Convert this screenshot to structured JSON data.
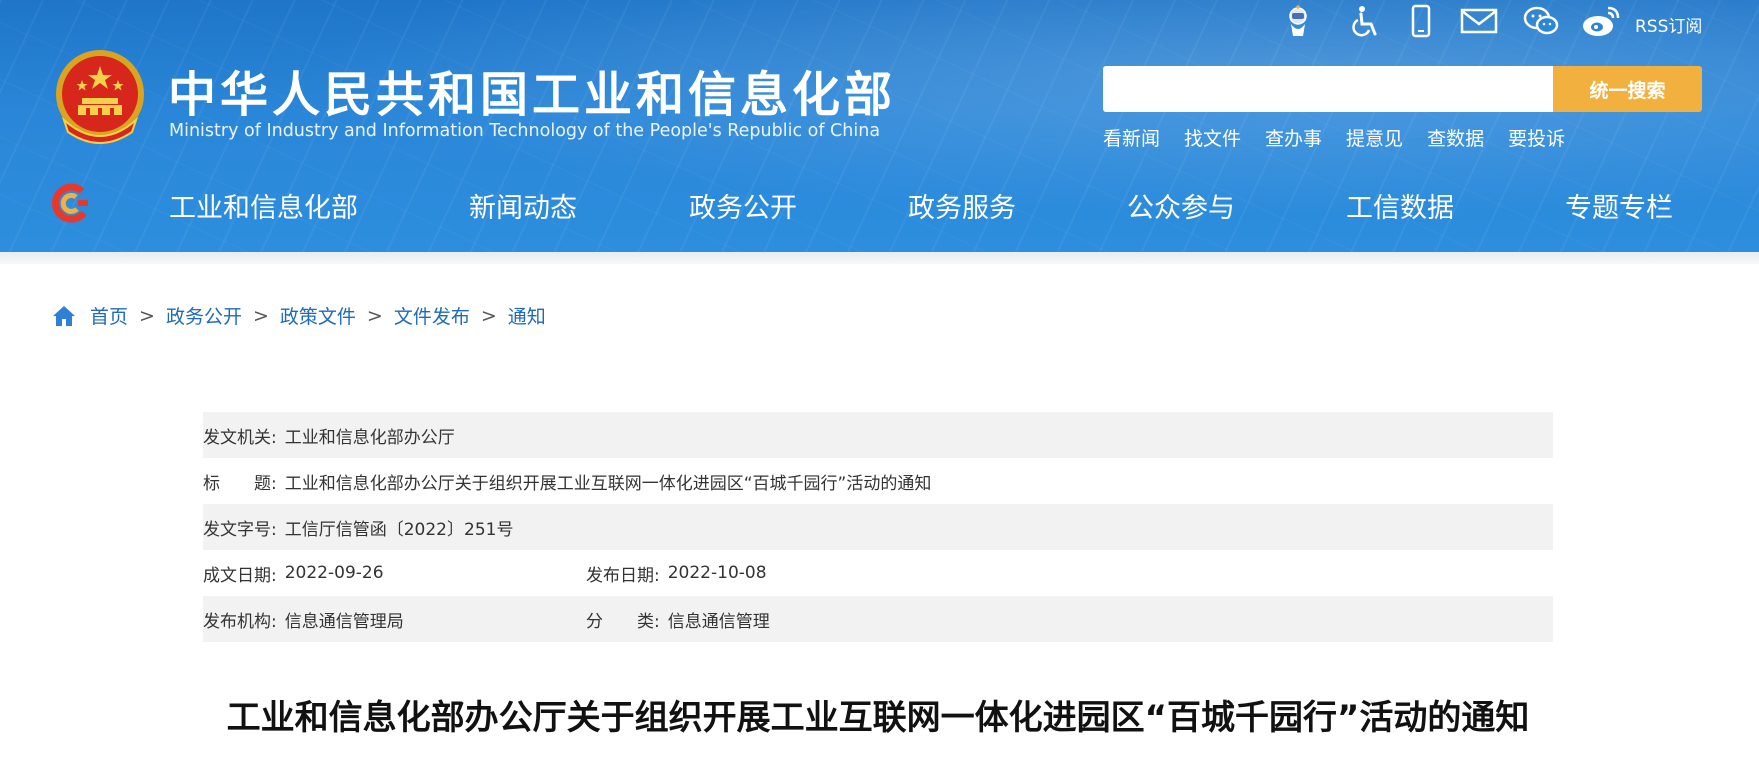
{
  "header": {
    "title": "中华人民共和国工业和信息化部",
    "subtitle": "Ministry of Industry and Information Technology of the People's Republic of China",
    "tools": [
      "robot-icon",
      "accessibility-icon",
      "mobile-icon",
      "mail-icon",
      "wechat-icon",
      "weibo-icon"
    ],
    "rss_label": "RSS订阅",
    "search": {
      "placeholder": "",
      "button_label": "统一搜索"
    },
    "quick_links": [
      "看新闻",
      "找文件",
      "查办事",
      "提意见",
      "查数据",
      "要投诉"
    ]
  },
  "nav": {
    "items": [
      "工业和信息化部",
      "新闻动态",
      "政务公开",
      "政务服务",
      "公众参与",
      "工信数据",
      "专题专栏"
    ]
  },
  "breadcrumb": [
    "首页",
    "政务公开",
    "政策文件",
    "文件发布",
    "通知"
  ],
  "breadcrumb_sep": ">",
  "meta": {
    "issuer_label": "发文机关:",
    "issuer": "工业和信息化部办公厅",
    "title_label": "标　　题:",
    "title": "工业和信息化部办公厅关于组织开展工业互联网一体化进园区“百城千园行”活动的通知",
    "doc_no_label": "发文字号:",
    "doc_no": "工信厅信管函〔2022〕251号",
    "written_date_label": "成文日期:",
    "written_date": "2022-09-26",
    "publish_date_label": "发布日期:",
    "publish_date": "2022-10-08",
    "publisher_label": "发布机构:",
    "publisher": "信息通信管理局",
    "category_label": "分　　类:",
    "category": "信息通信管理"
  },
  "document": {
    "title": "工业和信息化部办公厅关于组织开展工业互联网一体化进园区“百城千园行”活动的通知"
  },
  "colors": {
    "header_blue": "#2a86d8",
    "search_button": "#f2b03f",
    "link_blue": "#1f6bb8"
  }
}
